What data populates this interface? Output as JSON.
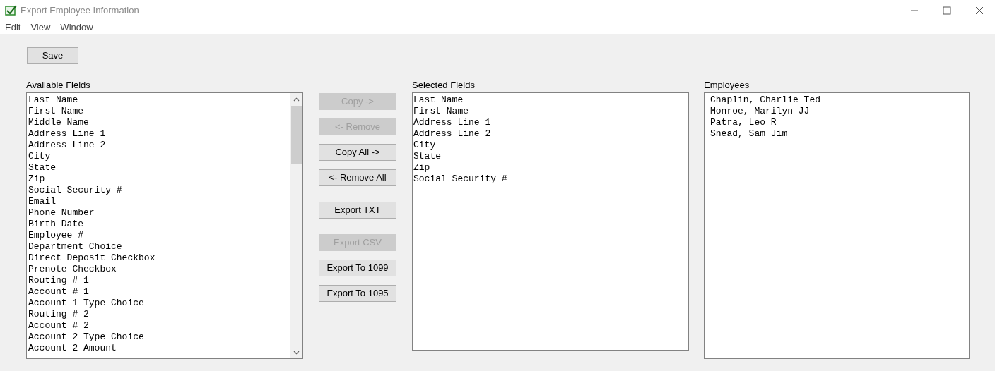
{
  "window": {
    "title": "Export Employee Information"
  },
  "menu": [
    "Edit",
    "View",
    "Window"
  ],
  "save_button": {
    "label": "Save",
    "disabled": false
  },
  "available_fields": {
    "label": "Available Fields",
    "items": [
      "Last Name",
      "First Name",
      "Middle Name",
      "Address Line 1",
      "Address Line 2",
      "City",
      "State",
      "Zip",
      "Social Security #",
      "Email",
      "Phone Number",
      "Birth Date",
      "Employee #",
      "Department Choice",
      "Direct Deposit Checkbox",
      "Prenote Checkbox",
      "Routing # 1",
      "Account # 1",
      "Account 1 Type Choice",
      "Routing # 2",
      "Account # 2",
      "Account 2 Type Choice",
      "Account 2 Amount"
    ]
  },
  "button_groups": [
    [
      {
        "label": "Copy ->",
        "disabled": true
      },
      {
        "label": "<- Remove",
        "disabled": true
      },
      {
        "label": "Copy All ->",
        "disabled": false
      },
      {
        "label": "<- Remove All",
        "disabled": false
      }
    ],
    [
      {
        "label": "Export TXT",
        "disabled": false
      }
    ],
    [
      {
        "label": "Export CSV",
        "disabled": true
      },
      {
        "label": "Export To 1099",
        "disabled": false
      },
      {
        "label": "Export To 1095",
        "disabled": false
      }
    ]
  ],
  "selected_fields": {
    "label": "Selected Fields",
    "items": [
      "Last Name",
      "First Name",
      "Address Line 1",
      "Address Line 2",
      "City",
      "State",
      "Zip",
      "Social Security #"
    ]
  },
  "employees": {
    "label": "Employees",
    "items": [
      "Chaplin, Charlie Ted",
      "Monroe, Marilyn JJ",
      "Patra, Leo R",
      "Snead, Sam Jim"
    ]
  }
}
